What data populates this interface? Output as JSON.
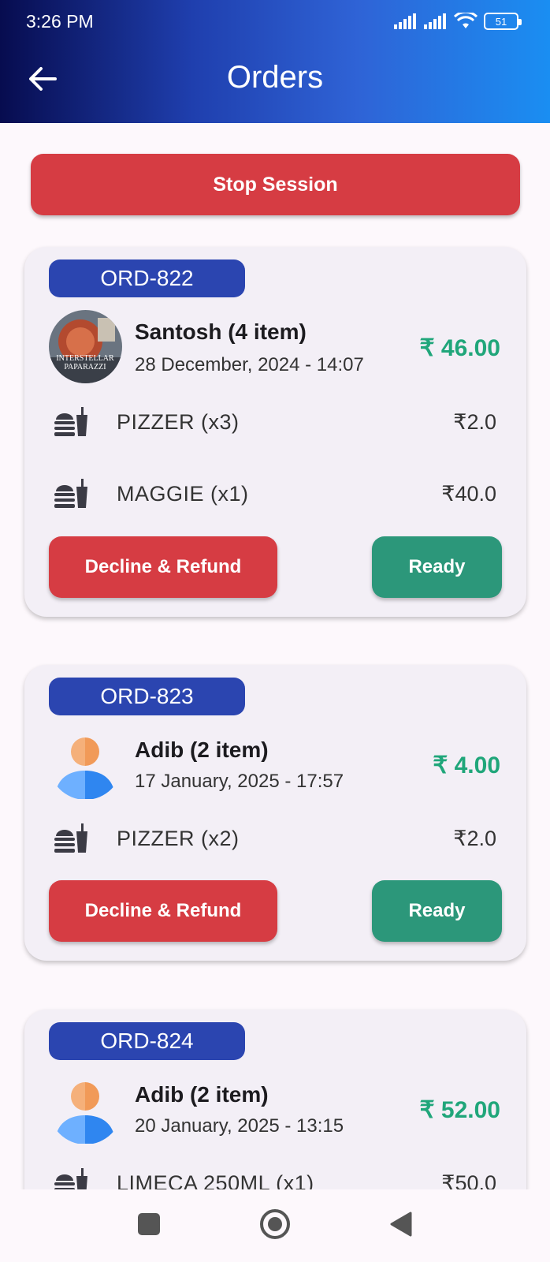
{
  "status_bar": {
    "time": "3:26 PM",
    "battery": "51"
  },
  "app_bar": {
    "title": "Orders"
  },
  "stop_session_label": "Stop Session",
  "colors": {
    "accent_red": "#d63c43",
    "accent_green": "#2c977a",
    "pill_blue": "#2b45b0",
    "price_green": "#20a67a"
  },
  "orders": [
    {
      "id": "ORD-822",
      "customer": "Santosh (4 item)",
      "datetime": "28 December, 2024 - 14:07",
      "total": "₹ 46.00",
      "avatar": "poster-image",
      "items": [
        {
          "name": "PIZZER (x3)",
          "price": "₹2.0",
          "icon": "fastfood-icon"
        },
        {
          "name": "MAGGIE (x1)",
          "price": "₹40.0",
          "icon": "fastfood-icon"
        }
      ],
      "decline_label": "Decline & Refund",
      "ready_label": "Ready"
    },
    {
      "id": "ORD-823",
      "customer": "Adib (2 item)",
      "datetime": "17 January, 2025 - 17:57",
      "total": "₹ 4.00",
      "avatar": "user-placeholder-icon",
      "items": [
        {
          "name": "PIZZER (x2)",
          "price": "₹2.0",
          "icon": "fastfood-icon"
        }
      ],
      "decline_label": "Decline & Refund",
      "ready_label": "Ready"
    },
    {
      "id": "ORD-824",
      "customer": "Adib (2 item)",
      "datetime": "20 January, 2025 - 13:15",
      "total": "₹ 52.00",
      "avatar": "user-placeholder-icon",
      "items": [
        {
          "name": "LIMECA 250ML (x1)",
          "price": "₹50.0",
          "icon": "fastfood-icon"
        }
      ]
    }
  ]
}
